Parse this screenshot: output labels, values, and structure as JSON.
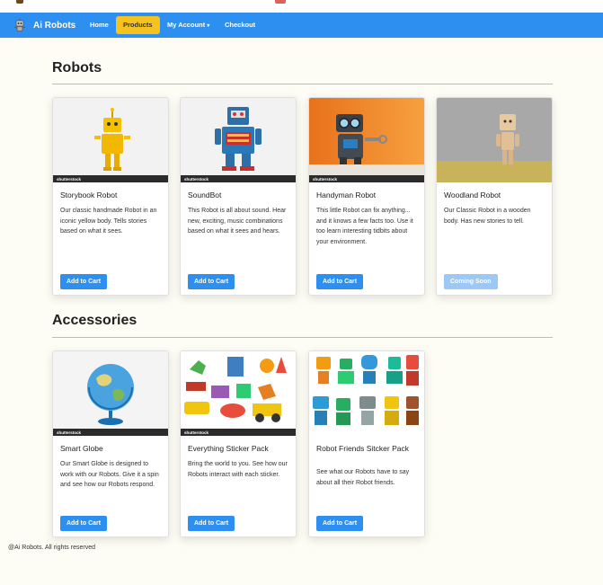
{
  "brand": {
    "name": "Ai Robots"
  },
  "nav": {
    "home": "Home",
    "products": "Products",
    "account": "My Account",
    "checkout": "Checkout"
  },
  "sections": {
    "robots": "Robots",
    "accessories": "Accessories"
  },
  "robots": [
    {
      "title": "Storybook Robot",
      "desc": "Our classic handmade Robot in an iconic yellow body. Tells stories based on what it sees.",
      "button": "Add to Cart",
      "watermark": "shutterstock"
    },
    {
      "title": "SoundBot",
      "desc": "This Robot is all about sound. Hear new, exciting, music combinations based on what it sees and hears.",
      "button": "Add to Cart",
      "watermark": "shutterstock"
    },
    {
      "title": "Handyman Robot",
      "desc": "This little Robot can fix anything... and it knows a few facts too. Use it too learn interesting tidbits about your environment.",
      "button": "Add to Cart",
      "watermark": "shutterstock"
    },
    {
      "title": "Woodland Robot",
      "desc": "Our Classic Robot in a wooden body. Has new stories to tell.",
      "button": "Coming Soon"
    }
  ],
  "accessories": [
    {
      "title": "Smart Globe",
      "desc": "Our Smart Globe is designed to work with our Robots. Give it a spin and see how our Robots respond.",
      "button": "Add to Cart",
      "watermark": "shutterstock"
    },
    {
      "title": "Everything Sticker Pack",
      "desc": "Bring the world to you. See how our Robots interact with each sticker.",
      "button": "Add to Cart",
      "watermark": "shutterstock"
    },
    {
      "title": "Robot Friends Sitcker Pack",
      "desc": "See what our Robots have to say about all their Robot friends.",
      "button": "Add to Cart"
    }
  ],
  "footer": "@Ai Robots. All rights reserved",
  "colors": {
    "navbar": "#2d8ff0",
    "active_tab": "#f6c21d",
    "button": "#2d8ff0",
    "button_disabled": "#9cc8f3"
  }
}
